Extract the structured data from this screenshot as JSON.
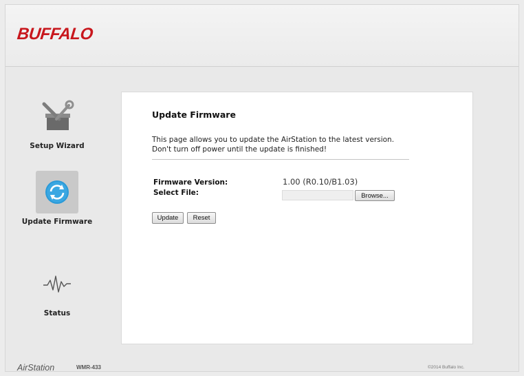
{
  "header": {
    "logo_text": "BUFFALO"
  },
  "sidebar": {
    "items": [
      {
        "label": "Setup Wizard",
        "icon": "toolbox-icon",
        "active": false
      },
      {
        "label": "Update Firmware",
        "icon": "refresh-icon",
        "active": true
      },
      {
        "label": "Status",
        "icon": "pulse-icon",
        "active": false
      }
    ]
  },
  "main": {
    "title": "Update Firmware",
    "description": "This page allows you to update the AirStation to the latest version. Don't turn off power until the update is finished!",
    "firmware_version_label": "Firmware Version:",
    "firmware_version_value": "1.00 (R0.10/B1.03)",
    "select_file_label": "Select File:",
    "select_file_value": "",
    "browse_label": "Browse...",
    "update_label": "Update",
    "reset_label": "Reset"
  },
  "footer": {
    "brand": "AirStation",
    "model": "WMR-433",
    "copyright": "©2014 Buffalo Inc."
  },
  "colors": {
    "brand_red": "#c8171d",
    "active_nav_bg": "#c9c9c9",
    "refresh_icon_blue": "#2a9ad8"
  }
}
